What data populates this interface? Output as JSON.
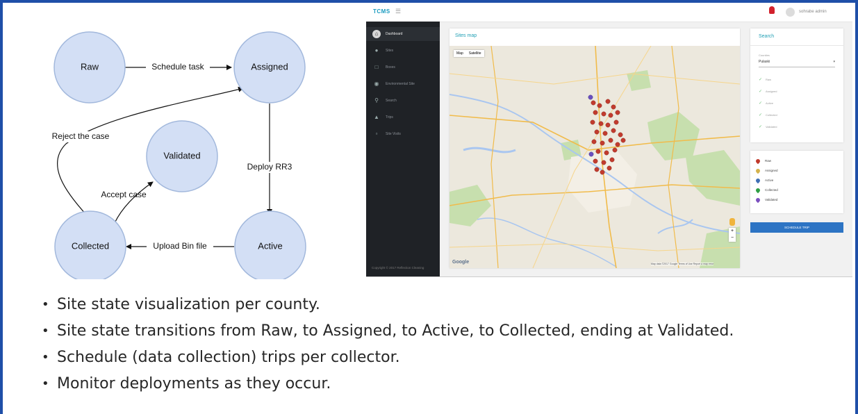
{
  "diagram": {
    "states": [
      {
        "id": "raw",
        "label": "Raw"
      },
      {
        "id": "assigned",
        "label": "Assigned"
      },
      {
        "id": "validated",
        "label": "Validated"
      },
      {
        "id": "collected",
        "label": "Collected"
      },
      {
        "id": "active",
        "label": "Active"
      }
    ],
    "transitions": [
      {
        "from": "raw",
        "to": "assigned",
        "label": "Schedule task"
      },
      {
        "from": "assigned",
        "to": "active",
        "label": "Deploy RR3"
      },
      {
        "from": "active",
        "to": "collected",
        "label": "Upload Bin file"
      },
      {
        "from": "collected",
        "to": "validated",
        "label": "Accept case"
      },
      {
        "from": "collected",
        "to": "assigned",
        "label": "Reject the case"
      }
    ]
  },
  "app": {
    "brand": "TCMS",
    "header": {
      "user": "sohrabe admin"
    },
    "sidebar": {
      "items": [
        "Dashboard",
        "Sites",
        "Boxes",
        "Environmental Site",
        "Search",
        "Trips",
        "Site Visits"
      ],
      "footer": "Copyright © 2017 Reflection Cleaning"
    },
    "map_card": {
      "title": "Sites map",
      "tabs": [
        "Map",
        "Satellite"
      ],
      "zoom_in": "+",
      "zoom_out": "−",
      "logo": "Google",
      "attribution": "Map data ©2017 Google   Terms of Use   Report a map error"
    },
    "search": {
      "title": "Search",
      "county_label": "Counties",
      "county_value": "Pulaski",
      "statuses": [
        "Raw",
        "Assigned",
        "Active",
        "Collected",
        "Validated"
      ]
    },
    "legend": {
      "items": [
        {
          "label": "Raw",
          "color": "#c0392b"
        },
        {
          "label": "Assigned",
          "color": "#d4b24c"
        },
        {
          "label": "Active",
          "color": "#3f6fb5"
        },
        {
          "label": "Collected",
          "color": "#2e9e44"
        },
        {
          "label": "Validated",
          "color": "#7b4fbf"
        }
      ]
    },
    "schedule_button": "SCHEDULE TRIP"
  },
  "bullets": [
    "Site state visualization per county.",
    "Site state transitions from Raw, to Assigned, to Active, to Collected, ending at Validated.",
    "Schedule (data collection) trips per collector.",
    "Monitor deployments as they occur."
  ]
}
